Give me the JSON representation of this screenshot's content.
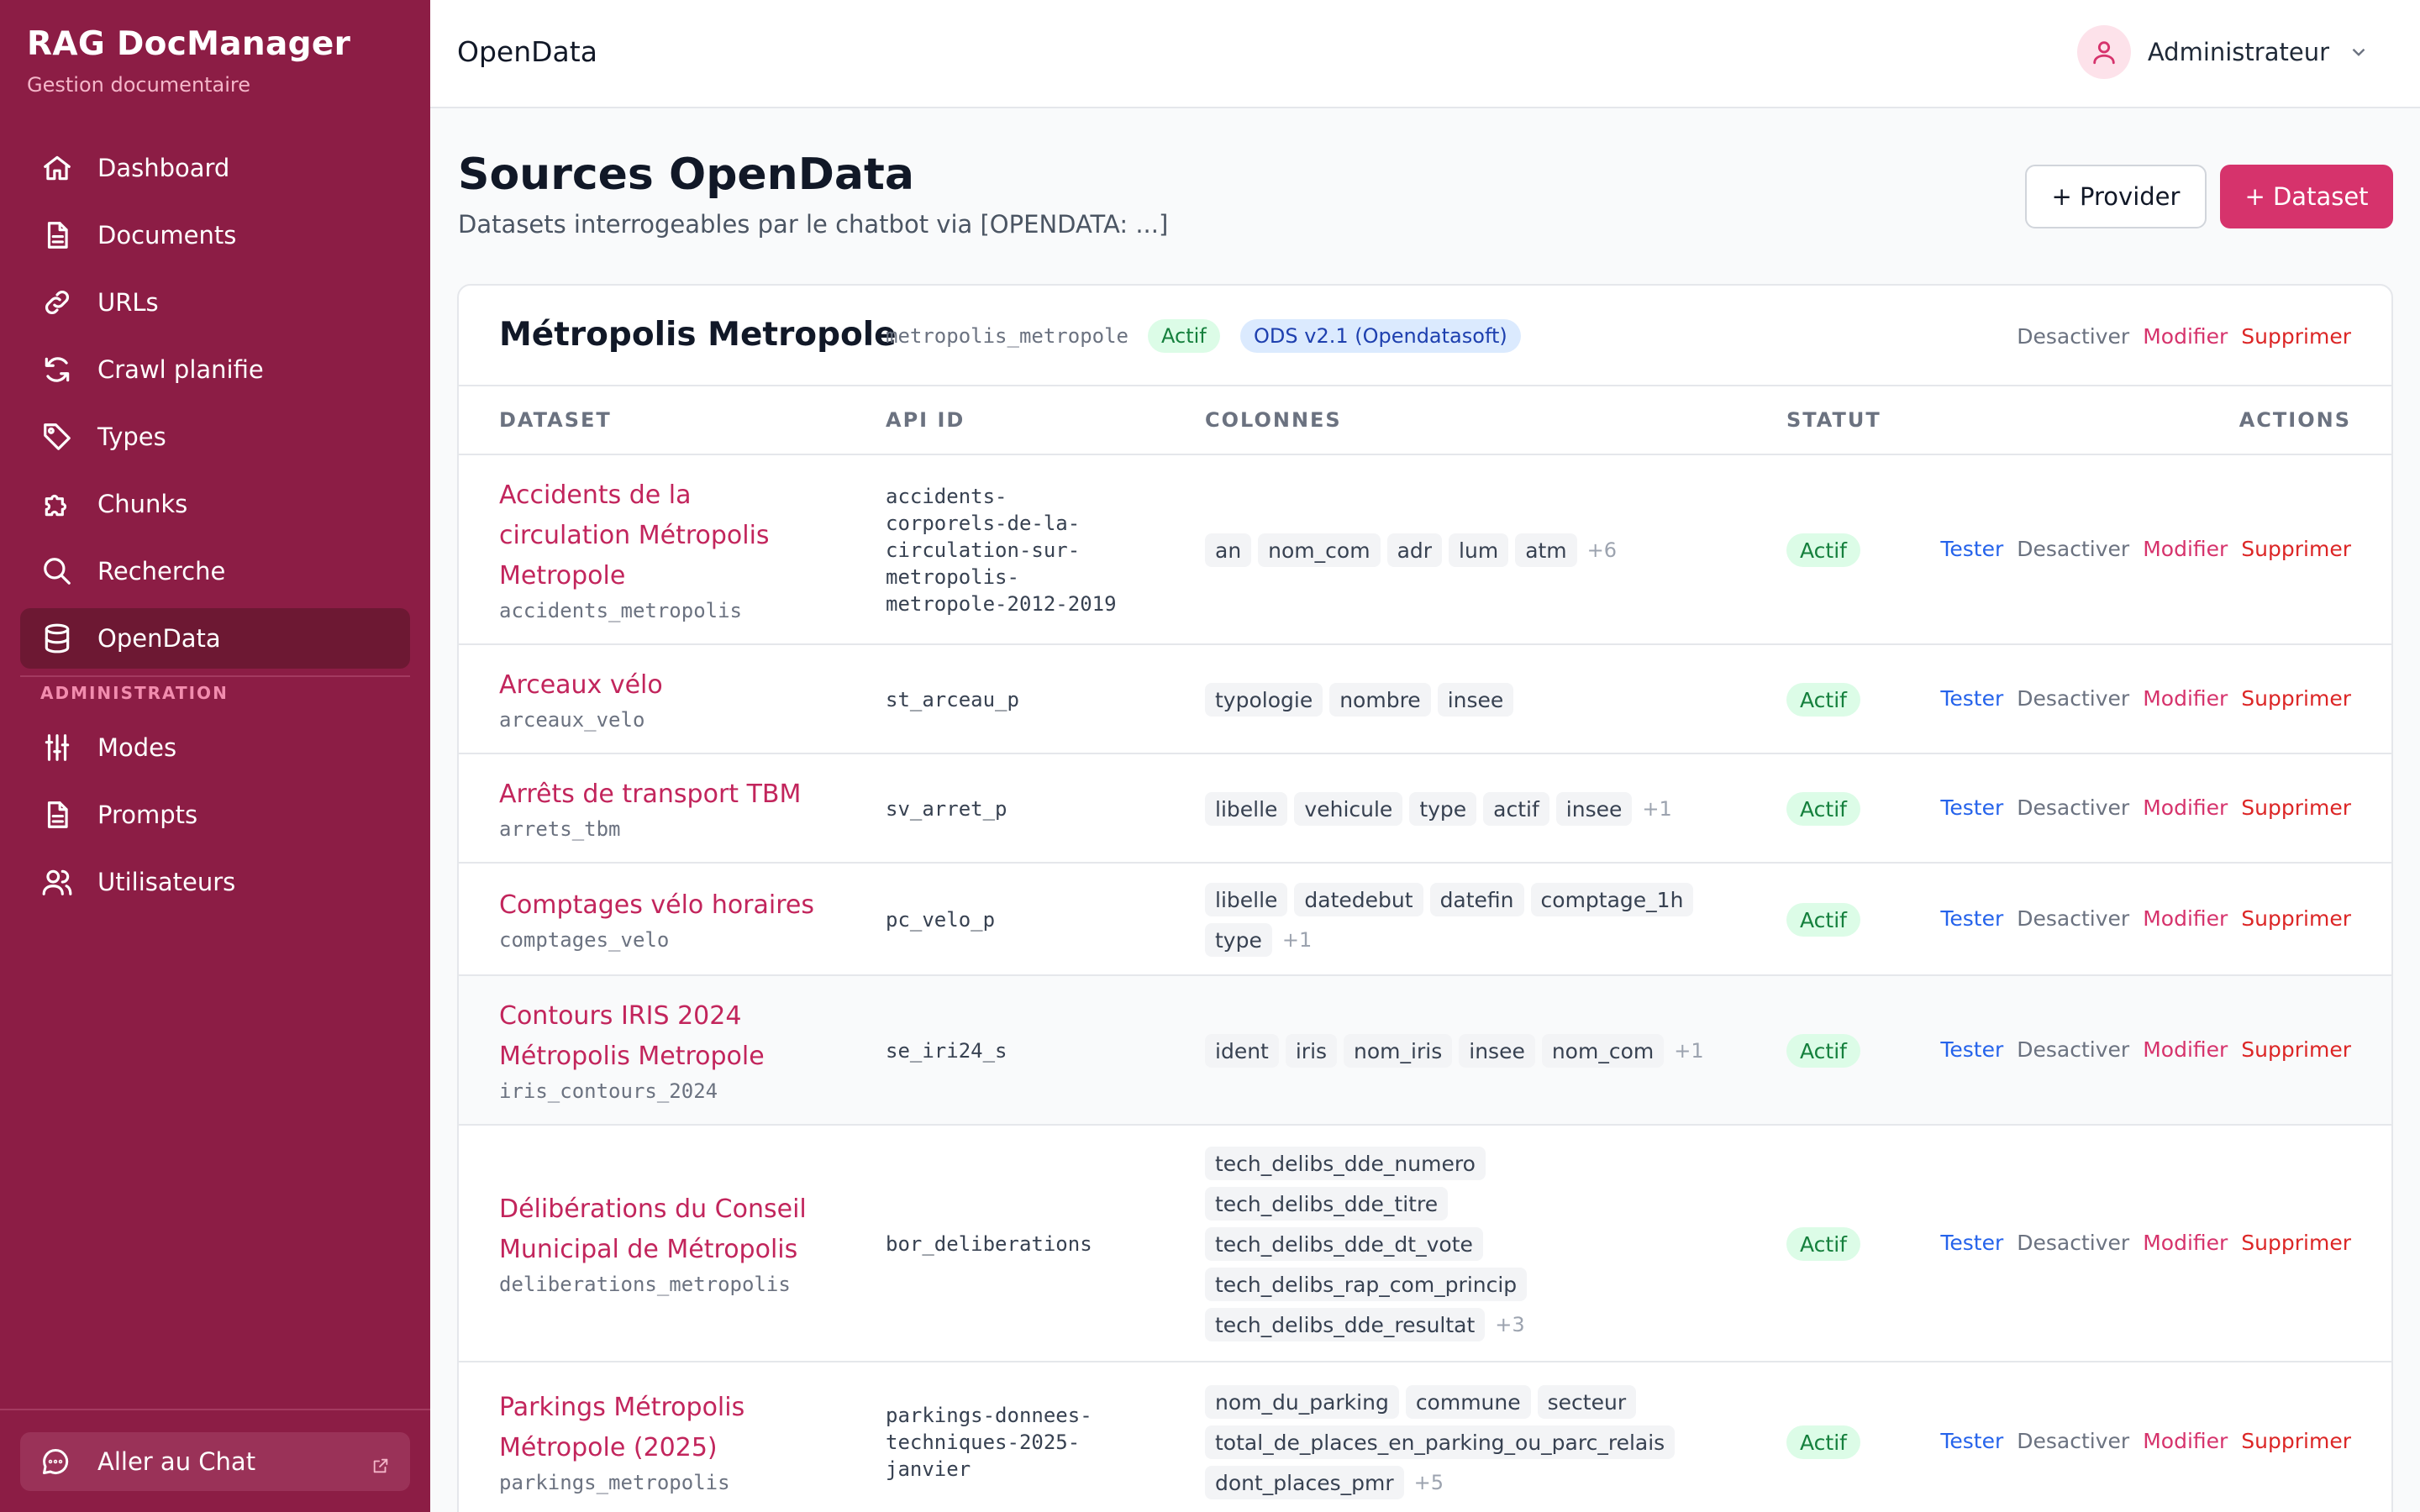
{
  "app": {
    "title": "RAG DocManager",
    "subtitle": "Gestion documentaire"
  },
  "colors": {
    "sidebar": "#8c1d45",
    "accent": "#d6336c",
    "active_nav": "#6d1833"
  },
  "nav": {
    "items": [
      {
        "label": "Dashboard",
        "icon": "home-icon"
      },
      {
        "label": "Documents",
        "icon": "document-icon"
      },
      {
        "label": "URLs",
        "icon": "link-icon"
      },
      {
        "label": "Crawl planifie",
        "icon": "refresh-icon"
      },
      {
        "label": "Types",
        "icon": "tag-icon"
      },
      {
        "label": "Chunks",
        "icon": "puzzle-icon"
      },
      {
        "label": "Recherche",
        "icon": "search-icon"
      },
      {
        "label": "OpenData",
        "icon": "database-icon",
        "active": true
      }
    ],
    "section_admin": "ADMINISTRATION",
    "admin_items": [
      {
        "label": "Modes",
        "icon": "sliders-icon"
      },
      {
        "label": "Prompts",
        "icon": "document-icon"
      },
      {
        "label": "Utilisateurs",
        "icon": "users-icon"
      }
    ],
    "chat_link": "Aller au Chat"
  },
  "topbar": {
    "title": "OpenData",
    "user": "Administrateur"
  },
  "page": {
    "title": "Sources OpenData",
    "subtitle": "Datasets interrogeables par le chatbot via [OPENDATA: ...]",
    "btn_provider": "+ Provider",
    "btn_dataset": "+ Dataset"
  },
  "provider": {
    "name": "Métropolis Metropole",
    "slug": "metropolis_metropole",
    "status": "Actif",
    "type": "ODS v2.1 (Opendatasoft)",
    "actions": {
      "deactivate": "Desactiver",
      "edit": "Modifier",
      "delete": "Supprimer"
    }
  },
  "table": {
    "headers": {
      "dataset": "DATASET",
      "api_id": "API ID",
      "columns": "COLONNES",
      "status": "STATUT",
      "actions": "ACTIONS"
    },
    "action_labels": {
      "test": "Tester",
      "deactivate": "Desactiver",
      "edit": "Modifier",
      "delete": "Supprimer"
    },
    "rows": [
      {
        "name_lines": [
          "Accidents de la",
          "circulation Métropolis",
          "Metropole"
        ],
        "slug": "accidents_metropolis",
        "api_id_lines": [
          "accidents-",
          "corporels-de-la-",
          "circulation-sur-",
          "metropolis-",
          "metropole-2012-2019"
        ],
        "columns": [
          [
            "an",
            "nom_com",
            "adr",
            "lum",
            "atm"
          ]
        ],
        "more": "+6",
        "status": "Actif"
      },
      {
        "name_lines": [
          "Arceaux vélo"
        ],
        "slug": "arceaux_velo",
        "api_id_lines": [
          "st_arceau_p"
        ],
        "columns": [
          [
            "typologie",
            "nombre",
            "insee"
          ]
        ],
        "more": "",
        "status": "Actif"
      },
      {
        "name_lines": [
          "Arrêts de transport TBM"
        ],
        "slug": "arrets_tbm",
        "api_id_lines": [
          "sv_arret_p"
        ],
        "columns": [
          [
            "libelle",
            "vehicule",
            "type",
            "actif",
            "insee"
          ]
        ],
        "more": "+1",
        "status": "Actif"
      },
      {
        "name_lines": [
          "Comptages vélo horaires"
        ],
        "slug": "comptages_velo",
        "api_id_lines": [
          "pc_velo_p"
        ],
        "columns": [
          [
            "libelle",
            "datedebut",
            "datefin",
            "comptage_1h"
          ],
          [
            "type"
          ]
        ],
        "more": "+1",
        "status": "Actif"
      },
      {
        "name_lines": [
          "Contours IRIS 2024",
          "Métropolis Metropole"
        ],
        "slug": "iris_contours_2024",
        "api_id_lines": [
          "se_iri24_s"
        ],
        "columns": [
          [
            "ident",
            "iris",
            "nom_iris",
            "insee",
            "nom_com"
          ]
        ],
        "more": "+1",
        "status": "Actif"
      },
      {
        "name_lines": [
          "Délibérations du Conseil",
          "Municipal de Métropolis"
        ],
        "slug": "deliberations_metropolis",
        "api_id_lines": [
          "bor_deliberations"
        ],
        "columns": [
          [
            "tech_delibs_dde_numero"
          ],
          [
            "tech_delibs_dde_titre"
          ],
          [
            "tech_delibs_dde_dt_vote"
          ],
          [
            "tech_delibs_rap_com_princip"
          ],
          [
            "tech_delibs_dde_resultat"
          ]
        ],
        "more": "+3",
        "status": "Actif"
      },
      {
        "name_lines": [
          "Parkings Métropolis",
          "Métropole (2025)"
        ],
        "slug": "parkings_metropolis",
        "api_id_lines": [
          "parkings-donnees-",
          "techniques-2025-",
          "janvier"
        ],
        "columns": [
          [
            "nom_du_parking",
            "commune",
            "secteur"
          ],
          [
            "total_de_places_en_parking_ou_parc_relais"
          ],
          [
            "dont_places_pmr"
          ]
        ],
        "more": "+5",
        "status": "Actif"
      }
    ]
  }
}
